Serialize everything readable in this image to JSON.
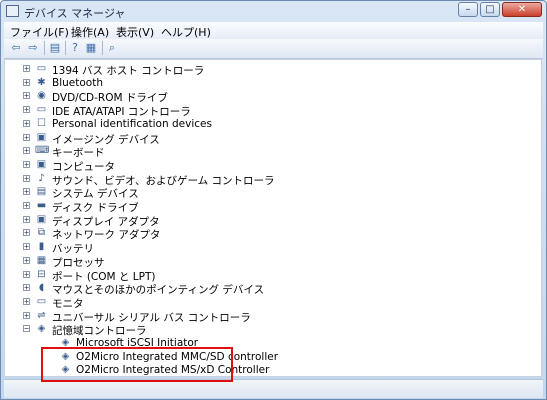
{
  "window": {
    "title": "デバイス マネージャ"
  },
  "menu": [
    {
      "label": "ファイル(F)"
    },
    {
      "label": "操作(A)"
    },
    {
      "label": "表示(V)"
    },
    {
      "label": "ヘルプ(H)"
    }
  ],
  "toolbar": {
    "back_icon": "arrow-left-icon",
    "forward_icon": "arrow-right-icon",
    "properties_icon": "properties-icon",
    "help_icon": "help-icon",
    "view_icon": "view-icon",
    "scan_icon": "scan-hardware-icon"
  },
  "tree": {
    "categories": [
      {
        "label": "1394 バス ホスト コントローラ",
        "icon": "1394-controller-icon"
      },
      {
        "label": "Bluetooth",
        "icon": "bluetooth-icon"
      },
      {
        "label": "DVD/CD-ROM ドライブ",
        "icon": "dvd-drive-icon"
      },
      {
        "label": "IDE ATA/ATAPI コントローラ",
        "icon": "ide-controller-icon"
      },
      {
        "label": "Personal identification devices",
        "icon": "id-device-icon"
      },
      {
        "label": "イメージング デバイス",
        "icon": "imaging-device-icon"
      },
      {
        "label": "キーボード",
        "icon": "keyboard-icon"
      },
      {
        "label": "コンピュータ",
        "icon": "computer-icon"
      },
      {
        "label": "サウンド、ビデオ、およびゲーム コントローラ",
        "icon": "sound-icon"
      },
      {
        "label": "システム デバイス",
        "icon": "system-device-icon"
      },
      {
        "label": "ディスク ドライブ",
        "icon": "disk-drive-icon"
      },
      {
        "label": "ディスプレイ アダプタ",
        "icon": "display-adapter-icon"
      },
      {
        "label": "ネットワーク アダプタ",
        "icon": "network-adapter-icon"
      },
      {
        "label": "バッテリ",
        "icon": "battery-icon"
      },
      {
        "label": "プロセッサ",
        "icon": "processor-icon"
      },
      {
        "label": "ポート (COM と LPT)",
        "icon": "port-icon"
      },
      {
        "label": "マウスとそのほかのポインティング デバイス",
        "icon": "mouse-icon"
      },
      {
        "label": "モニタ",
        "icon": "monitor-icon"
      },
      {
        "label": "ユニバーサル シリアル バス コントローラ",
        "icon": "usb-controller-icon"
      }
    ],
    "expanded": {
      "label": "記憶域コントローラ",
      "icon": "storage-controller-icon",
      "children": [
        {
          "label": "Microsoft iSCSI Initiator",
          "icon": "storage-device-icon"
        },
        {
          "label": "O2Micro Integrated MMC/SD controller",
          "icon": "storage-device-icon"
        },
        {
          "label": "O2Micro Integrated MS/xD Controller",
          "icon": "storage-device-icon"
        }
      ]
    }
  },
  "colors": {
    "highlight_border": "#e01010"
  }
}
